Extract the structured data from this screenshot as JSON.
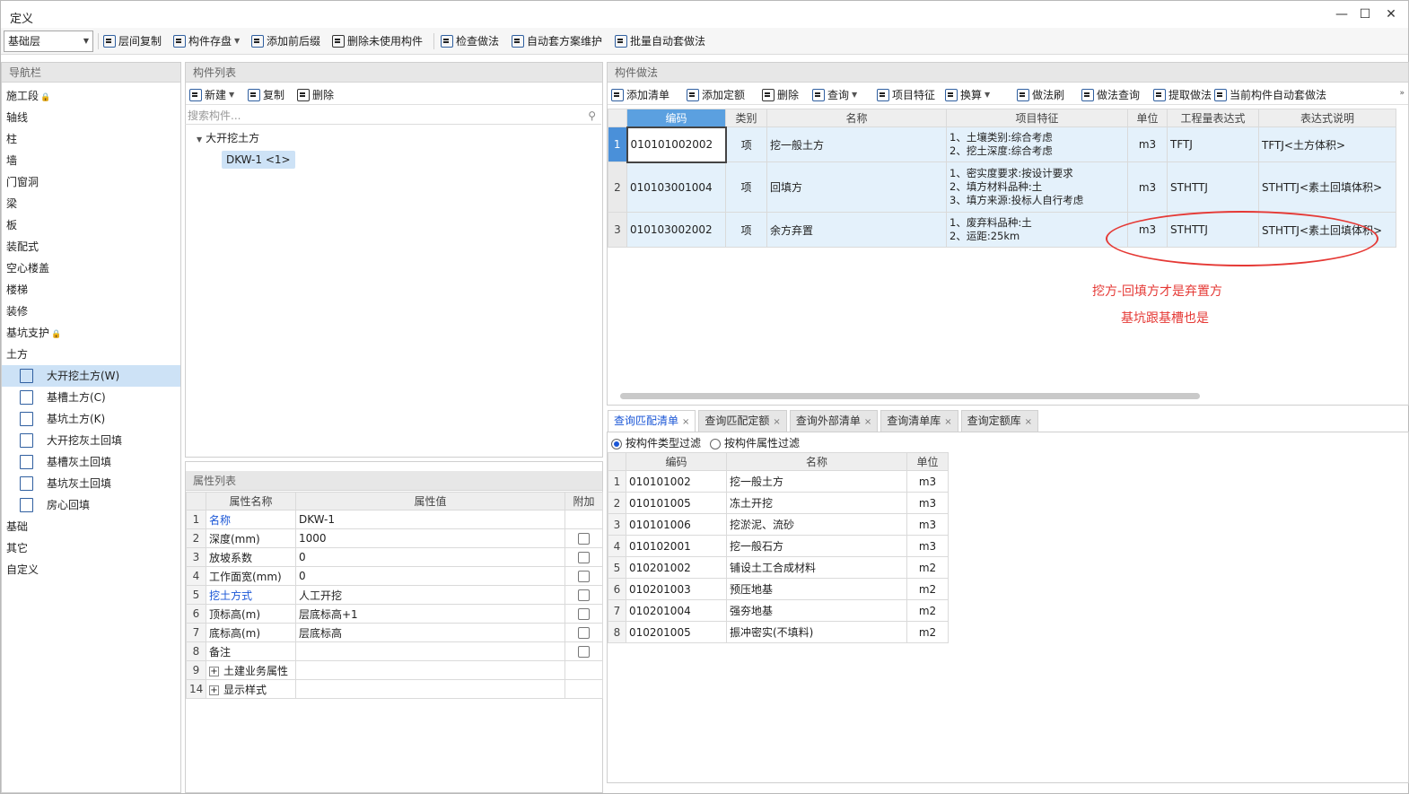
{
  "window": {
    "title": "定义",
    "minimize": "—",
    "maximize": "☐",
    "close": "✕"
  },
  "toolbar": {
    "floor": "基础层",
    "buttons": [
      "层间复制",
      "构件存盘",
      "添加前后缀",
      "删除未使用构件",
      "检查做法",
      "自动套方案维护",
      "批量自动套做法"
    ]
  },
  "nav": {
    "title": "导航栏",
    "items": [
      {
        "label": "施工段",
        "lock": "🔒"
      },
      {
        "label": "轴线"
      },
      {
        "label": "柱"
      },
      {
        "label": "墙"
      },
      {
        "label": "门窗洞"
      },
      {
        "label": "梁"
      },
      {
        "label": "板"
      },
      {
        "label": "装配式"
      },
      {
        "label": "空心楼盖"
      },
      {
        "label": "楼梯"
      },
      {
        "label": "装修"
      },
      {
        "label": "基坑支护",
        "lock": "🔒"
      },
      {
        "label": "土方"
      }
    ],
    "subitems": [
      "大开挖土方(W)",
      "基槽土方(C)",
      "基坑土方(K)",
      "大开挖灰土回填",
      "基槽灰土回填",
      "基坑灰土回填",
      "房心回填"
    ],
    "after": [
      "基础",
      "其它",
      "自定义"
    ]
  },
  "components": {
    "title": "构件列表",
    "new": "新建",
    "copy": "复制",
    "delete": "删除",
    "search_placeholder": "搜索构件...",
    "tree_parent": "大开挖土方",
    "tree_child": "DKW-1 <1>"
  },
  "props": {
    "title": "属性列表",
    "headers": [
      "属性名称",
      "属性值",
      "附加"
    ],
    "rows": [
      {
        "n": "1",
        "name": "名称",
        "value": "DKW-1",
        "blue": true,
        "cb": false
      },
      {
        "n": "2",
        "name": "深度(mm)",
        "value": "1000",
        "cb": true
      },
      {
        "n": "3",
        "name": "放坡系数",
        "value": "0",
        "cb": true
      },
      {
        "n": "4",
        "name": "工作面宽(mm)",
        "value": "0",
        "cb": true
      },
      {
        "n": "5",
        "name": "挖土方式",
        "value": "人工开挖",
        "blue": true,
        "cb": true
      },
      {
        "n": "6",
        "name": "顶标高(m)",
        "value": "层底标高+1",
        "cb": true
      },
      {
        "n": "7",
        "name": "底标高(m)",
        "value": "层底标高",
        "cb": true
      },
      {
        "n": "8",
        "name": "备注",
        "value": "",
        "cb": true
      },
      {
        "n": "9",
        "name": "土建业务属性",
        "value": "",
        "plus": true
      },
      {
        "n": "14",
        "name": "显示样式",
        "value": "",
        "plus": true
      }
    ]
  },
  "methods": {
    "title": "构件做法",
    "buttons": [
      "添加清单",
      "添加定额",
      "删除",
      "查询",
      "项目特征",
      "换算",
      "做法刷",
      "做法查询",
      "提取做法",
      "当前构件自动套做法"
    ],
    "headers": [
      "编码",
      "类别",
      "名称",
      "项目特征",
      "单位",
      "工程量表达式",
      "表达式说明"
    ],
    "rows": [
      {
        "n": "1",
        "code": "010101002002",
        "cat": "项",
        "name": "挖一般土方",
        "feat": "1、土壤类别:综合考虑\n2、挖土深度:综合考虑",
        "unit": "m3",
        "expr": "TFTJ",
        "desc": "TFTJ<土方体积>"
      },
      {
        "n": "2",
        "code": "010103001004",
        "cat": "项",
        "name": "回填方",
        "feat": "1、密实度要求:按设计要求\n2、填方材料品种:土\n3、填方来源:投标人自行考虑",
        "unit": "m3",
        "expr": "STHTTJ",
        "desc": "STHTTJ<素土回填体积>"
      },
      {
        "n": "3",
        "code": "010103002002",
        "cat": "项",
        "name": "余方弃置",
        "feat": "1、废弃料品种:土\n2、运距:25km",
        "unit": "m3",
        "expr": "STHTTJ",
        "desc": "STHTTJ<素土回填体积>"
      }
    ]
  },
  "annotation": {
    "line1": "挖方-回填方才是弃置方",
    "line2": "基坑跟基槽也是"
  },
  "query": {
    "tabs": [
      "查询匹配清单",
      "查询匹配定额",
      "查询外部清单",
      "查询清单库",
      "查询定额库"
    ],
    "close": "×",
    "filter1": "按构件类型过滤",
    "filter2": "按构件属性过滤",
    "headers": [
      "编码",
      "名称",
      "单位"
    ],
    "rows": [
      {
        "n": "1",
        "code": "010101002",
        "name": "挖一般土方",
        "unit": "m3"
      },
      {
        "n": "2",
        "code": "010101005",
        "name": "冻土开挖",
        "unit": "m3"
      },
      {
        "n": "3",
        "code": "010101006",
        "name": "挖淤泥、流砂",
        "unit": "m3"
      },
      {
        "n": "4",
        "code": "010102001",
        "name": "挖一般石方",
        "unit": "m3"
      },
      {
        "n": "5",
        "code": "010201002",
        "name": "铺设土工合成材料",
        "unit": "m2"
      },
      {
        "n": "6",
        "code": "010201003",
        "name": "预压地基",
        "unit": "m2"
      },
      {
        "n": "7",
        "code": "010201004",
        "name": "强夯地基",
        "unit": "m2"
      },
      {
        "n": "8",
        "code": "010201005",
        "name": "振冲密实(不填料)",
        "unit": "m2"
      }
    ]
  }
}
